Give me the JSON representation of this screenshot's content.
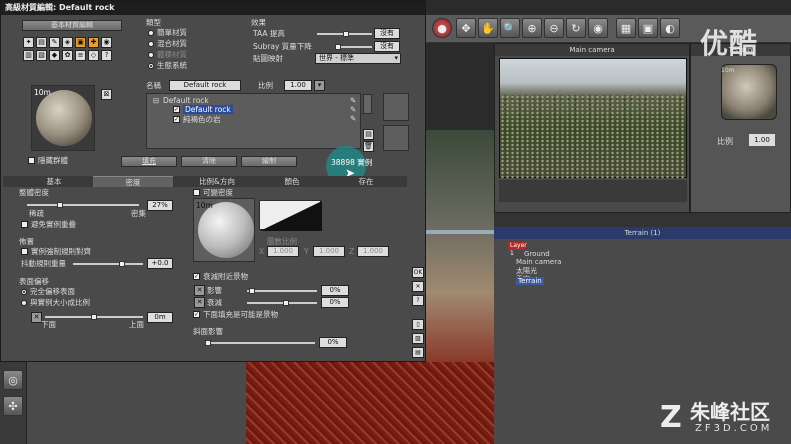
{
  "dialog": {
    "title": "高級材質編輯: Default rock",
    "top_button": "基本材質編輯",
    "type_label": "類型",
    "types": [
      "簡單材質",
      "混合材質",
      "體積材質",
      "生態系統"
    ],
    "effects_label": "效果",
    "taa_label": "TAA 提高",
    "taa_value": "沒有",
    "subray_label": "Subray 質量下降",
    "subray_value": "沒有",
    "mapping_label": "貼圖映射",
    "mapping_value": "世界 - 標準",
    "name_label": "名稱",
    "name_value": "Default rock",
    "scale_label": "比例",
    "scale_value": "1.00",
    "thumb_zoom": "10m",
    "tree_root": "Default rock",
    "tree_child1": "Default rock",
    "tree_child2": "純褐色の岩",
    "hide_label": "隱藏群體",
    "btn_fill": "填充",
    "btn_clear": "清除",
    "btn_paint": "繪制",
    "instances": "38898 實例",
    "tabs": [
      "基本",
      "密度",
      "比例&方向",
      "顏色",
      "存在"
    ],
    "overall_density": "整體密度",
    "density_sparse": "稀疏",
    "density_dense": "密集",
    "density_value": "27%",
    "avoid_overlap": "避免實例重疊",
    "layout_label": "佈置",
    "force_regular": "實例強制規則對齊",
    "jitter_label": "抖動規則重量",
    "jitter_value": "+0.0",
    "surface_offset": "表面偏移",
    "offset_opt1": "完全偏移表面",
    "offset_opt2": "與實例大小成比例",
    "offset_below": "下面",
    "offset_above": "上面",
    "offset_value": "0m",
    "variable_density": "可變密度",
    "sphere_zoom": "10m",
    "shader_scale": "圖數比例",
    "sx": "1.000",
    "sy": "1.000",
    "sz": "1.000",
    "decay_label": "衰減附近景物",
    "influence_label": "影響",
    "influence_value": "0%",
    "decay2_label": "衰減",
    "decay2_value": "0%",
    "below_fill": "下面填充是可能是景物",
    "slope_label": "斜面影響",
    "slope_value": "0%"
  },
  "camera": {
    "title": "Main camera"
  },
  "terrain_panel": {
    "title": "Terrain",
    "zoom": "10m",
    "scale_label": "比例",
    "scale_value": "1.00"
  },
  "scene": {
    "header": "Terrain (1)",
    "layer": "Layer 1",
    "items": [
      "Ground",
      "Main camera",
      "太陽光",
      "天空",
      "Terrain"
    ]
  },
  "watermarks": {
    "youku": "优酷",
    "zf_cn": "朱峰社区",
    "zf_en": "ZF3D.COM"
  }
}
